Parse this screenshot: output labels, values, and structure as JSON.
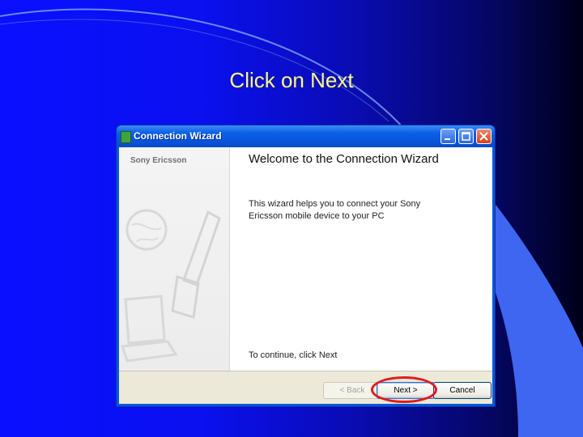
{
  "slide": {
    "title": "Click on Next"
  },
  "window": {
    "title": "Connection Wizard",
    "brand": "Sony Ericsson",
    "heading": "Welcome to the Connection Wizard",
    "description": "This wizard helps you to connect your Sony Ericsson mobile device to your PC",
    "continue_text": "To continue, click Next",
    "buttons": {
      "back": "< Back",
      "next": "Next >",
      "cancel": "Cancel"
    }
  },
  "colors": {
    "slide_blue": "#0a10ff",
    "slide_light_blue": "#3f66f0",
    "title_text": "#f6f6a0",
    "xp_title_bar": "#0a5fe6",
    "highlight_red": "#e21a1a"
  }
}
